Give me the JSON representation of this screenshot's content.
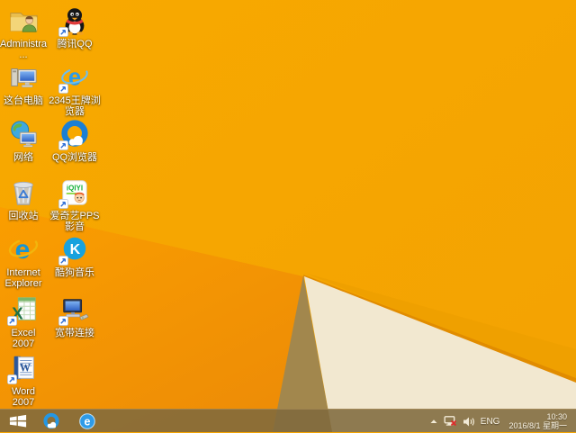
{
  "desktop": {
    "icons": [
      {
        "id": "administrator",
        "label": "Administra..."
      },
      {
        "id": "tencent-qq",
        "label": "腾讯QQ"
      },
      {
        "id": "this-pc",
        "label": "这台电脑"
      },
      {
        "id": "2345-explorer",
        "label": "2345王牌浏览器"
      },
      {
        "id": "network",
        "label": "网络"
      },
      {
        "id": "qq-browser",
        "label": "QQ浏览器"
      },
      {
        "id": "recycle-bin",
        "label": "回收站"
      },
      {
        "id": "iqiyi-pps",
        "label": "爱奇艺PPS 影音"
      },
      {
        "id": "internet-explorer",
        "label": "Internet Explorer"
      },
      {
        "id": "kugou-music",
        "label": "酷狗音乐"
      },
      {
        "id": "excel-2007",
        "label": "Excel 2007"
      },
      {
        "id": "broadband",
        "label": "宽带连接"
      },
      {
        "id": "word-2007",
        "label": "Word 2007"
      }
    ]
  },
  "taskbar": {
    "buttons": [
      {
        "id": "start",
        "label": "Start"
      },
      {
        "id": "qq-browser-task",
        "label": "QQ浏览器"
      },
      {
        "id": "2345-explorer-task",
        "label": "2345王牌浏览器"
      }
    ],
    "tray": {
      "language": "ENG",
      "time": "10:30",
      "date": "2016/8/1 星期一"
    }
  },
  "colors": {
    "wallpaper_orange": "#F6A502",
    "wallpaper_bright": "#FA9D00",
    "wallpaper_deep": "#EE8D06",
    "wallpaper_olive": "#A2874D",
    "wallpaper_cream": "#F2E8D0",
    "wallpaper_edge_stripe": "#E18C00",
    "taskbar_tint": "#806A3E",
    "label_text": "#FFFFFF"
  }
}
